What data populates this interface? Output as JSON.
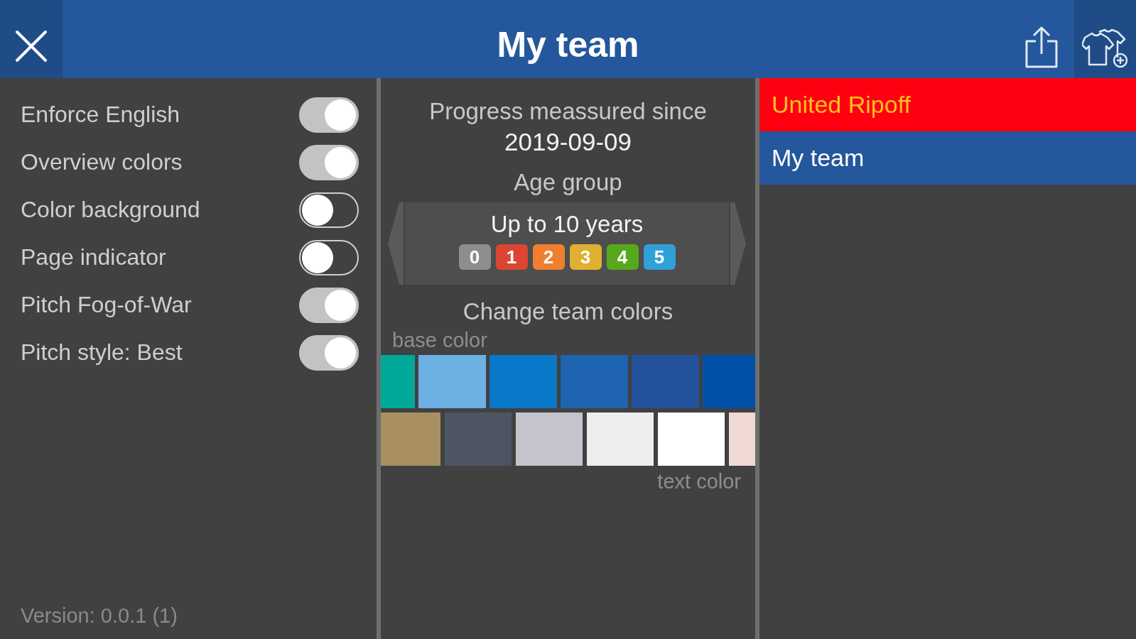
{
  "header": {
    "title": "My team"
  },
  "settings": [
    {
      "label": "Enforce English",
      "on": true
    },
    {
      "label": "Overview colors",
      "on": true
    },
    {
      "label": "Color background",
      "on": false
    },
    {
      "label": "Page indicator",
      "on": false
    },
    {
      "label": "Pitch Fog-of-War",
      "on": true
    },
    {
      "label": "Pitch style: Best",
      "on": true
    }
  ],
  "version": "Version: 0.0.1 (1)",
  "progress": {
    "label": "Progress meassured since",
    "date": "2019-09-09"
  },
  "age_group": {
    "label": "Age group",
    "value": "Up to 10 years",
    "levels": [
      {
        "text": "0",
        "color": "#8e8e8e"
      },
      {
        "text": "1",
        "color": "#dc4433"
      },
      {
        "text": "2",
        "color": "#f07f30"
      },
      {
        "text": "3",
        "color": "#dfb032"
      },
      {
        "text": "4",
        "color": "#58a81c"
      },
      {
        "text": "5",
        "color": "#2fa0d8"
      }
    ]
  },
  "team_colors": {
    "title": "Change team colors",
    "base_label": "base color",
    "base_colors": [
      {
        "color": "#00a89a"
      },
      {
        "color": "#6cb0e4"
      },
      {
        "color": "#0a78c8"
      },
      {
        "color": "#1e64b0"
      },
      {
        "color": "#225299"
      },
      {
        "color": "#0050a8"
      }
    ],
    "text_colors": [
      {
        "color": "#a89060"
      },
      {
        "color": "#4d5563"
      },
      {
        "color": "#c4c4cc"
      },
      {
        "color": "#efedef"
      },
      {
        "color": "#ffffff"
      },
      {
        "color": "#f0d8d4"
      }
    ],
    "text_label": "text color"
  },
  "teams": [
    {
      "color": "#ff0010",
      "label": {
        "text": "United Ripoff",
        "color": "#ffc020"
      }
    },
    {
      "color": "#24579b",
      "label": {
        "text": "My team",
        "color": "#ffffff"
      }
    }
  ]
}
